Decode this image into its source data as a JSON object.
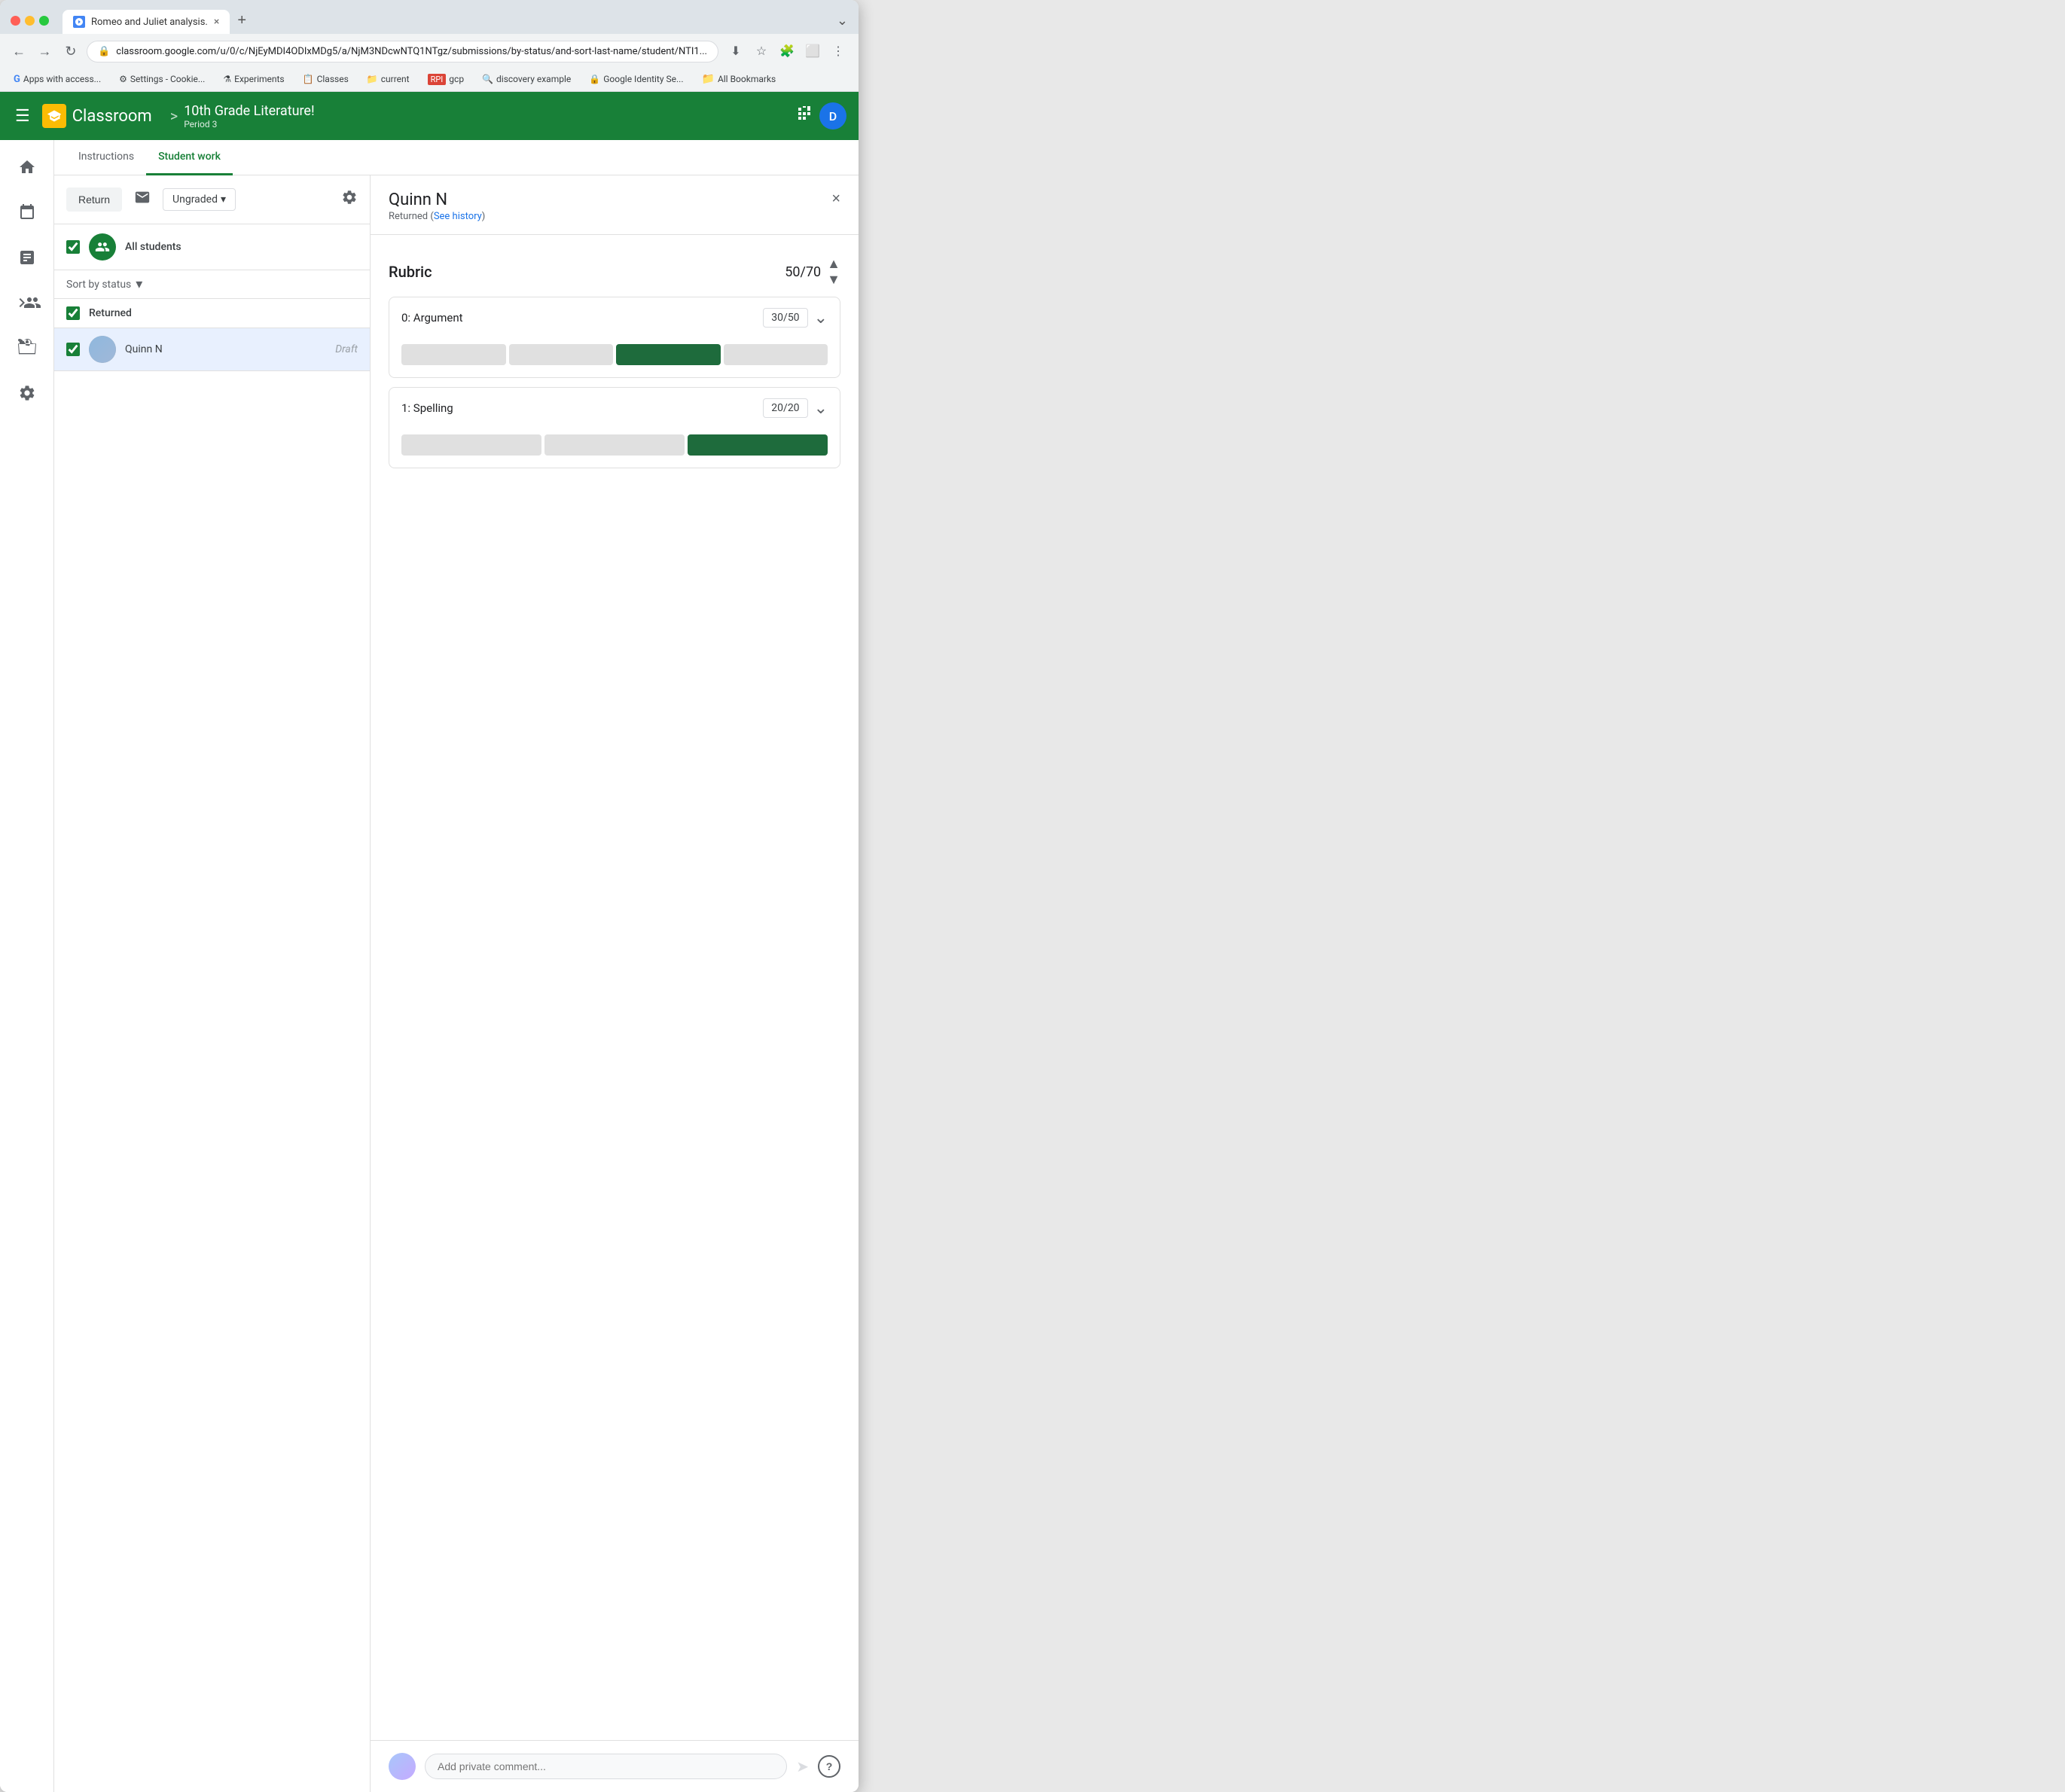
{
  "browser": {
    "tab_title": "Romeo and Juliet analysis.",
    "tab_close": "×",
    "url": "classroom.google.com/u/0/c/NjEyMDI4ODIxMDg5/a/NjM3NDcwNTQ1NTgz/submissions/by-status/and-sort-last-name/student/NTI1...",
    "new_tab_label": "+",
    "more_label": "⌄"
  },
  "bookmarks": [
    {
      "icon": "G",
      "label": "Apps with access...",
      "color": "#4285f4"
    },
    {
      "icon": "⚙",
      "label": "Settings - Cookie..."
    },
    {
      "icon": "⚗",
      "label": "Experiments"
    },
    {
      "icon": "📋",
      "label": "Classes"
    },
    {
      "icon": "📁",
      "label": "current"
    },
    {
      "icon": "R",
      "label": "gcp",
      "color": "#db4437"
    },
    {
      "icon": "🔍",
      "label": "discovery example"
    },
    {
      "icon": "🔒",
      "label": "Google Identity Se..."
    },
    {
      "icon": "📁",
      "label": "All Bookmarks"
    }
  ],
  "header": {
    "hamburger": "☰",
    "logo_text": "Classroom",
    "breadcrumb_arrow": ">",
    "course_title": "10th Grade Literature!",
    "course_subtitle": "Period 3",
    "grid_icon": "⊞",
    "user_initial": "D"
  },
  "sidebar": {
    "items": [
      {
        "icon": "🏠",
        "label": "home"
      },
      {
        "icon": "📅",
        "label": "calendar"
      },
      {
        "icon": "📋",
        "label": "todo"
      },
      {
        "icon": "👥",
        "label": "people-expand",
        "expandable": true
      },
      {
        "icon": "⬇",
        "label": "archive"
      },
      {
        "icon": "⚙",
        "label": "settings"
      }
    ]
  },
  "tabs": {
    "items": [
      {
        "label": "Instructions",
        "active": false
      },
      {
        "label": "Student work",
        "active": true
      }
    ]
  },
  "toolbar": {
    "return_label": "Return",
    "email_icon": "✉",
    "filter_label": "Ungraded",
    "filter_arrow": "▾",
    "settings_icon": "⚙"
  },
  "student_list": {
    "all_students_label": "All students",
    "sort_label": "Sort by status",
    "sort_arrow": "▾",
    "status_group": "Returned",
    "students": [
      {
        "name": "Quinn N",
        "status": "Draft",
        "checked": true
      }
    ]
  },
  "detail": {
    "student_name": "Quinn N",
    "student_status": "Returned (See history)",
    "see_history_label": "See history",
    "close_icon": "×",
    "rubric": {
      "title": "Rubric",
      "total_score": "50",
      "total_max": "70",
      "score_up": "⌃",
      "score_down": "⌄",
      "criteria": [
        {
          "name": "0: Argument",
          "score": "30",
          "max": "50",
          "bars": [
            {
              "selected": false
            },
            {
              "selected": false
            },
            {
              "selected": true
            },
            {
              "selected": false
            }
          ],
          "chevron": "⌄"
        },
        {
          "name": "1: Spelling",
          "score": "20",
          "max": "20",
          "bars": [
            {
              "selected": false
            },
            {
              "selected": false
            },
            {
              "selected": true
            }
          ],
          "chevron": "⌄"
        }
      ]
    },
    "comment": {
      "placeholder": "Add private comment...",
      "send_icon": "➤",
      "help_icon": "?"
    }
  }
}
